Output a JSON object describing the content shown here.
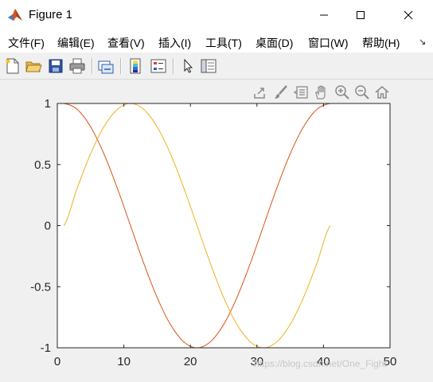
{
  "window": {
    "title": "Figure 1",
    "icon": "matlab-logo-icon",
    "controls": [
      "minimize-icon",
      "maximize-icon",
      "close-icon"
    ]
  },
  "menu": {
    "items": [
      "文件(F)",
      "编辑(E)",
      "查看(V)",
      "插入(I)",
      "工具(T)",
      "桌面(D)",
      "窗口(W)",
      "帮助(H)"
    ],
    "overflow_icon": "menu-overflow-icon"
  },
  "toolbar": {
    "icons": [
      "new-figure-icon",
      "open-file-icon",
      "save-icon",
      "print-icon",
      "link-plot-icon",
      "insert-colorbar-icon",
      "insert-legend-icon",
      "edit-plot-pointer-icon",
      "property-inspector-icon"
    ]
  },
  "axes_toolbar": {
    "icons": [
      "export-icon",
      "brush-icon",
      "data-tips-icon",
      "pan-hand-icon",
      "zoom-in-icon",
      "zoom-out-icon",
      "home-restore-icon"
    ]
  },
  "chart_data": {
    "type": "line",
    "x_range": [
      1,
      41
    ],
    "xlim": [
      0,
      50
    ],
    "ylim": [
      -1,
      1
    ],
    "xticks": [
      0,
      10,
      20,
      30,
      40,
      50
    ],
    "yticks": [
      -1,
      -0.5,
      0,
      0.5,
      1
    ],
    "xtick_labels": [
      "0",
      "10",
      "20",
      "30",
      "40",
      "50"
    ],
    "ytick_labels": [
      "-1",
      "-0.5",
      "0",
      "0.5",
      "1"
    ],
    "grid": false,
    "box": true,
    "series": [
      {
        "color": "#D95319",
        "x": [
          1,
          3,
          5,
          7,
          9,
          11,
          13,
          15,
          17,
          19,
          21,
          23,
          25,
          27,
          29,
          31,
          33,
          35,
          37,
          39,
          41
        ],
        "y": [
          1.0,
          0.951,
          0.809,
          0.588,
          0.309,
          0.0,
          -0.309,
          -0.588,
          -0.809,
          -0.951,
          -1.0,
          -0.951,
          -0.809,
          -0.588,
          -0.309,
          0.0,
          0.309,
          0.588,
          0.809,
          0.951,
          1.0
        ]
      },
      {
        "color": "#EDB120",
        "x": [
          1,
          3,
          5,
          7,
          9,
          11,
          13,
          15,
          17,
          19,
          21,
          23,
          25,
          27,
          29,
          31,
          33,
          35,
          37,
          39,
          41
        ],
        "y": [
          0.0,
          0.309,
          0.588,
          0.809,
          0.951,
          1.0,
          0.951,
          0.809,
          0.588,
          0.309,
          0.0,
          -0.309,
          -0.588,
          -0.809,
          -0.951,
          -1.0,
          -0.951,
          -0.809,
          -0.588,
          -0.309,
          0.0
        ]
      }
    ]
  },
  "watermark": "https://blog.csdn.net/One_Fight"
}
